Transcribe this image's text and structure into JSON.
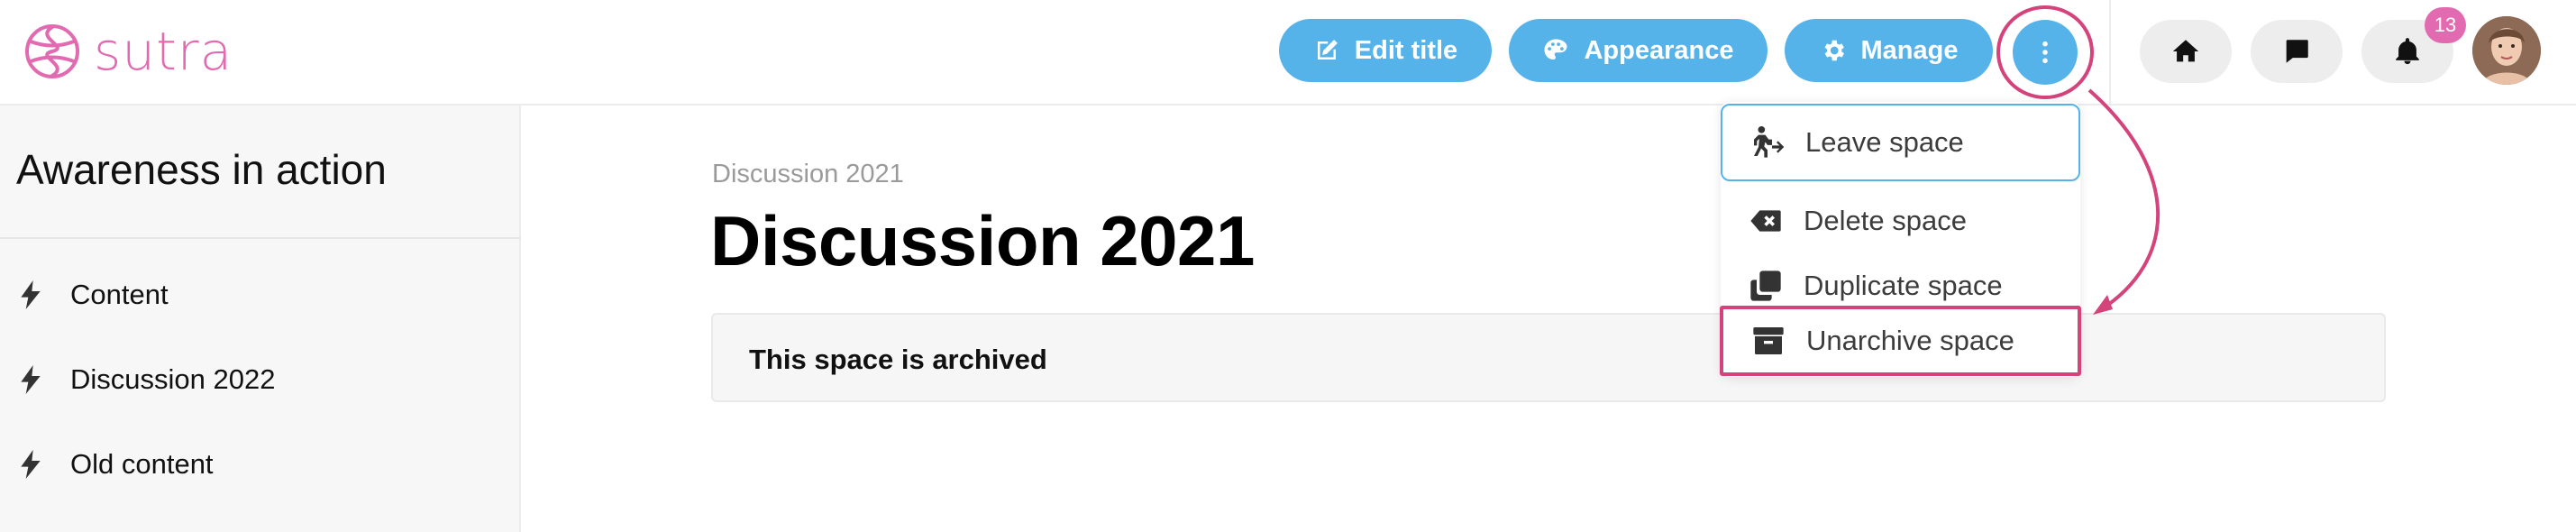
{
  "brand": {
    "name": "sutra",
    "color": "#e26ab0"
  },
  "header": {
    "edit_title": "Edit title",
    "appearance": "Appearance",
    "manage": "Manage",
    "notification_count": "13",
    "accent": "#56b3ea"
  },
  "sidebar": {
    "title": "Awareness in action",
    "items": [
      {
        "label": "Content",
        "icon": "bolt-icon"
      },
      {
        "label": "Discussion 2022",
        "icon": "bolt-icon"
      },
      {
        "label": "Old content",
        "icon": "bolt-icon"
      }
    ]
  },
  "main": {
    "breadcrumb": "Discussion 2021",
    "title": "Discussion 2021",
    "archived_notice": "This space is archived"
  },
  "menu": {
    "items": [
      {
        "label": "Leave space",
        "icon": "person-exit-icon"
      },
      {
        "label": "Delete space",
        "icon": "backspace-icon"
      },
      {
        "label": "Duplicate space",
        "icon": "copy-icon"
      },
      {
        "label": "Unarchive space",
        "icon": "archive-icon"
      }
    ],
    "highlight": "#d4437c"
  }
}
